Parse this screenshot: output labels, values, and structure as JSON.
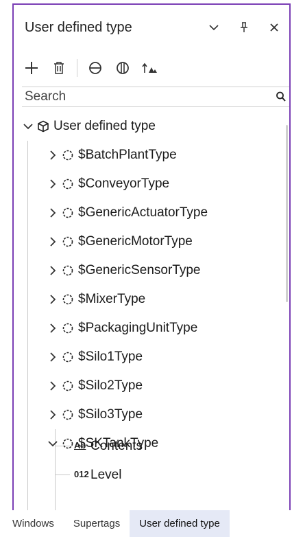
{
  "panel": {
    "title": "User defined type",
    "title_icons": [
      "chevron-down-icon",
      "pin-icon",
      "close-icon"
    ]
  },
  "toolbar": {
    "items": [
      "add-icon",
      "delete-icon",
      "collapse-icon",
      "expand-icon",
      "sort-icon"
    ]
  },
  "search": {
    "placeholder": "Search"
  },
  "tree": {
    "root": {
      "label": "User defined type",
      "expanded": true
    },
    "types": [
      {
        "label": "$BatchPlantType",
        "expanded": false
      },
      {
        "label": "$ConveyorType",
        "expanded": false
      },
      {
        "label": "$GenericActuatorType",
        "expanded": false
      },
      {
        "label": "$GenericMotorType",
        "expanded": false
      },
      {
        "label": "$GenericSensorType",
        "expanded": false
      },
      {
        "label": "$MixerType",
        "expanded": false
      },
      {
        "label": "$PackagingUnitType",
        "expanded": false
      },
      {
        "label": "$Silo1Type",
        "expanded": false
      },
      {
        "label": "$Silo2Type",
        "expanded": false
      },
      {
        "label": "$Silo3Type",
        "expanded": false
      },
      {
        "label": "$SKTankType",
        "expanded": true
      }
    ],
    "children": [
      {
        "label": "Contents",
        "type_badge": "Ab"
      },
      {
        "label": "Level",
        "type_badge": "012"
      }
    ]
  },
  "bottom_tabs": [
    {
      "label": "Windows",
      "active": false
    },
    {
      "label": "Supertags",
      "active": false
    },
    {
      "label": "User defined type",
      "active": true
    }
  ],
  "colors": {
    "frame": "#7b3fb5",
    "active_tab": "#e5e9f6"
  }
}
